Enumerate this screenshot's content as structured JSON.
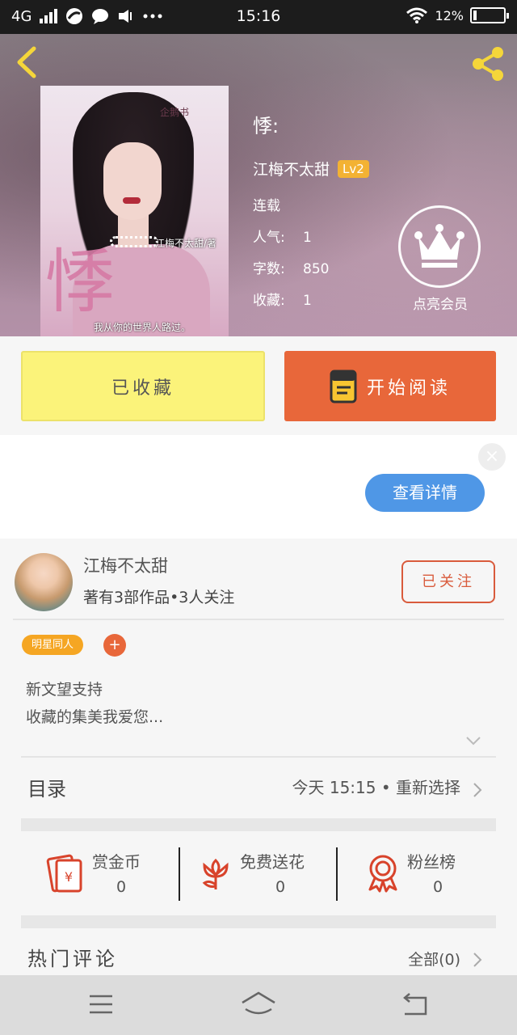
{
  "status_bar": {
    "network": "4G",
    "time": "15:16",
    "battery": "12%",
    "battery_level": 0.12
  },
  "header": {
    "back_icon": "chevron-left-icon",
    "share_icon": "share-icon",
    "cover": {
      "big_char": "悸",
      "tag": "企鹅书",
      "author_watermark": "江梅不太甜/著",
      "slogan": "我从你的世界人路过。"
    },
    "book": {
      "title": "悸:",
      "author": "江梅不太甜",
      "level": "Lv2",
      "status": "连载",
      "stats": [
        {
          "key": "人气:",
          "value": "1"
        },
        {
          "key": "字数:",
          "value": "850"
        },
        {
          "key": "收藏:",
          "value": "1"
        }
      ]
    },
    "vip": {
      "icon": "crown-icon",
      "label": "点亮会员"
    }
  },
  "actions": {
    "collected_label": "已收藏",
    "read_label": "开始阅读",
    "read_icon": "book-icon"
  },
  "ad": {
    "close_icon": "close-icon",
    "detail_label": "查看详情"
  },
  "author_card": {
    "name": "江梅不太甜",
    "meta": "著有3部作品•3人关注",
    "follow_label": "已关注"
  },
  "tags": {
    "items": [
      "明星同人"
    ],
    "add_label": "+"
  },
  "description": {
    "lines": [
      "新文望支持",
      "收藏的集美我爱您..."
    ]
  },
  "catalog": {
    "label": "目录",
    "value": "今天 15:15 • 重新选择"
  },
  "rewards": [
    {
      "label": "赏金币",
      "value": "0",
      "icon": "red-envelope-icon"
    },
    {
      "label": "免费送花",
      "value": "0",
      "icon": "flower-icon"
    },
    {
      "label": "粉丝榜",
      "value": "0",
      "icon": "medal-icon"
    }
  ],
  "comments": {
    "label": "热门评论",
    "value": "全部(0)"
  },
  "navbar": {
    "menu_icon": "menu-icon",
    "home_icon": "home-icon",
    "back_icon": "back-icon"
  },
  "colors": {
    "accent_orange": "#e8673a",
    "yellow_button": "#fbf37a",
    "blue_button": "#4f97e6",
    "level_badge": "#f3b233",
    "tag": "#f5a623"
  }
}
